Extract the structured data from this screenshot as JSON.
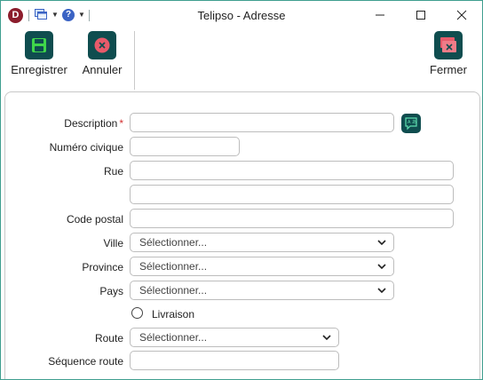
{
  "window": {
    "title": "Telipso - Adresse",
    "app_logo_letter": "D",
    "help_glyph": "?",
    "icons": [
      "app-logo-icon",
      "windows-icon",
      "help-icon",
      "minimize-icon",
      "maximize-icon",
      "close-icon"
    ]
  },
  "ribbon": {
    "save_label": "Enregistrer",
    "cancel_label": "Annuler",
    "close_label": "Fermer"
  },
  "form": {
    "description": {
      "label": "Description",
      "required_mark": "*",
      "value": ""
    },
    "street_number": {
      "label": "Numéro civique",
      "value": ""
    },
    "street": {
      "label": "Rue",
      "value": ""
    },
    "street2": {
      "value": ""
    },
    "postal_code": {
      "label": "Code postal",
      "value": ""
    },
    "city": {
      "label": "Ville",
      "selected": "Sélectionner..."
    },
    "province": {
      "label": "Province",
      "selected": "Sélectionner..."
    },
    "country": {
      "label": "Pays",
      "selected": "Sélectionner..."
    },
    "delivery": {
      "label": "Livraison",
      "checked": false
    },
    "route": {
      "label": "Route",
      "selected": "Sélectionner..."
    },
    "route_sequence": {
      "label": "Séquence route",
      "value": ""
    }
  },
  "colors": {
    "accent_dark": "#0f4d4f",
    "save_green": "#3fd64a",
    "cancel_red": "#e85a6a",
    "required_red": "#d32f2f",
    "window_border": "#3f9e8f"
  }
}
